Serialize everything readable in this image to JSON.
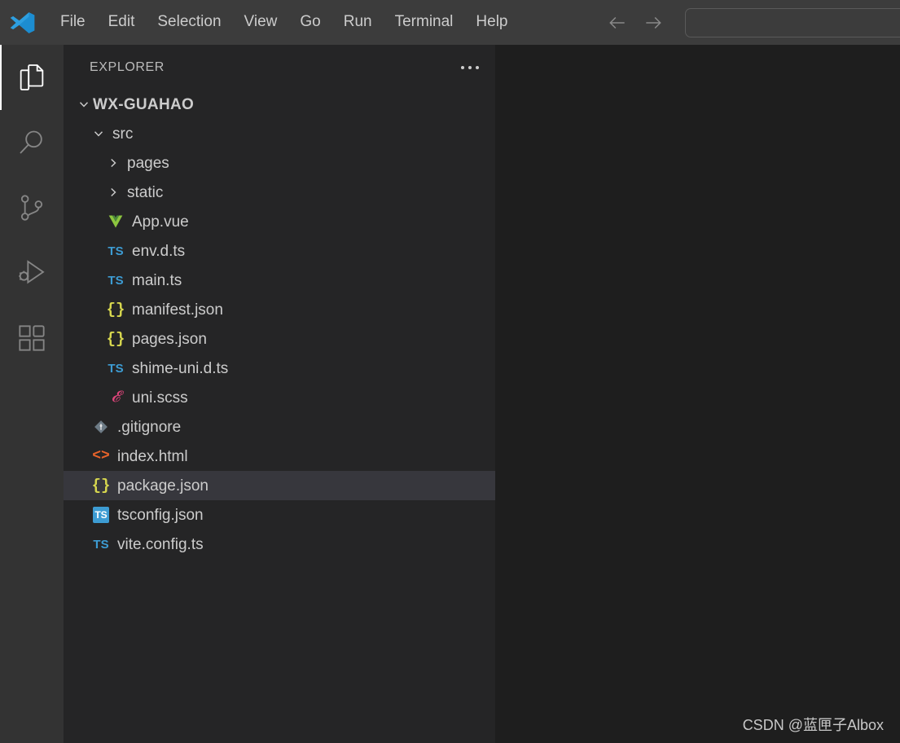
{
  "titlebar": {
    "logo_icon": "vscode-logo-icon",
    "menu": [
      {
        "label": "File"
      },
      {
        "label": "Edit"
      },
      {
        "label": "Selection"
      },
      {
        "label": "View"
      },
      {
        "label": "Go"
      },
      {
        "label": "Run"
      },
      {
        "label": "Terminal"
      },
      {
        "label": "Help"
      }
    ],
    "nav_back_icon": "arrow-left-icon",
    "nav_forward_icon": "arrow-right-icon",
    "command_center_value": "",
    "command_center_placeholder": ""
  },
  "activitybar": {
    "items": [
      {
        "name": "explorer",
        "icon": "files-icon",
        "active": true
      },
      {
        "name": "search",
        "icon": "search-icon",
        "active": false
      },
      {
        "name": "source-control",
        "icon": "source-control-icon",
        "active": false
      },
      {
        "name": "run-debug",
        "icon": "run-debug-icon",
        "active": false
      },
      {
        "name": "extensions",
        "icon": "extensions-icon",
        "active": false
      }
    ]
  },
  "sidebar": {
    "title": "EXPLORER",
    "actions_icon": "more-actions-icon",
    "tree": [
      {
        "label": "WX-GUAHAO",
        "type": "folder-root",
        "expanded": true,
        "depth": 0,
        "icon": "chevron-down-icon",
        "selected": false
      },
      {
        "label": "src",
        "type": "folder",
        "expanded": true,
        "depth": 1,
        "icon": "chevron-down-icon",
        "selected": false
      },
      {
        "label": "pages",
        "type": "folder",
        "expanded": false,
        "depth": 2,
        "icon": "chevron-right-icon",
        "selected": false
      },
      {
        "label": "static",
        "type": "folder",
        "expanded": false,
        "depth": 2,
        "icon": "chevron-right-icon",
        "selected": false
      },
      {
        "label": "App.vue",
        "type": "file",
        "depth": 2,
        "icon": "vue-file-icon",
        "selected": false
      },
      {
        "label": "env.d.ts",
        "type": "file",
        "depth": 2,
        "icon": "typescript-file-icon",
        "selected": false
      },
      {
        "label": "main.ts",
        "type": "file",
        "depth": 2,
        "icon": "typescript-file-icon",
        "selected": false
      },
      {
        "label": "manifest.json",
        "type": "file",
        "depth": 2,
        "icon": "json-file-icon",
        "selected": false
      },
      {
        "label": "pages.json",
        "type": "file",
        "depth": 2,
        "icon": "json-file-icon",
        "selected": false
      },
      {
        "label": "shime-uni.d.ts",
        "type": "file",
        "depth": 2,
        "icon": "typescript-file-icon",
        "selected": false
      },
      {
        "label": "uni.scss",
        "type": "file",
        "depth": 2,
        "icon": "scss-file-icon",
        "selected": false
      },
      {
        "label": ".gitignore",
        "type": "file",
        "depth": 1,
        "icon": "git-file-icon",
        "selected": false
      },
      {
        "label": "index.html",
        "type": "file",
        "depth": 1,
        "icon": "html-file-icon",
        "selected": false
      },
      {
        "label": "package.json",
        "type": "file",
        "depth": 1,
        "icon": "json-file-icon",
        "selected": true
      },
      {
        "label": "tsconfig.json",
        "type": "file",
        "depth": 1,
        "icon": "tsconfig-file-icon",
        "selected": false
      },
      {
        "label": "vite.config.ts",
        "type": "file",
        "depth": 1,
        "icon": "typescript-file-icon",
        "selected": false
      }
    ]
  },
  "editor": {
    "watermark": "CSDN @蓝匣子Albox"
  },
  "colors": {
    "titlebar_bg": "#3c3c3c",
    "activitybar_bg": "#333333",
    "sidebar_bg": "#252526",
    "editor_bg": "#1e1e1e",
    "selection_bg": "#37373d",
    "text": "#cccccc",
    "accent_blue": "#3d9cd3",
    "json_yellow": "#d7d74f",
    "html_orange": "#e8632a",
    "scss_pink": "#e0457b",
    "vue_green": "#7ec04b"
  }
}
